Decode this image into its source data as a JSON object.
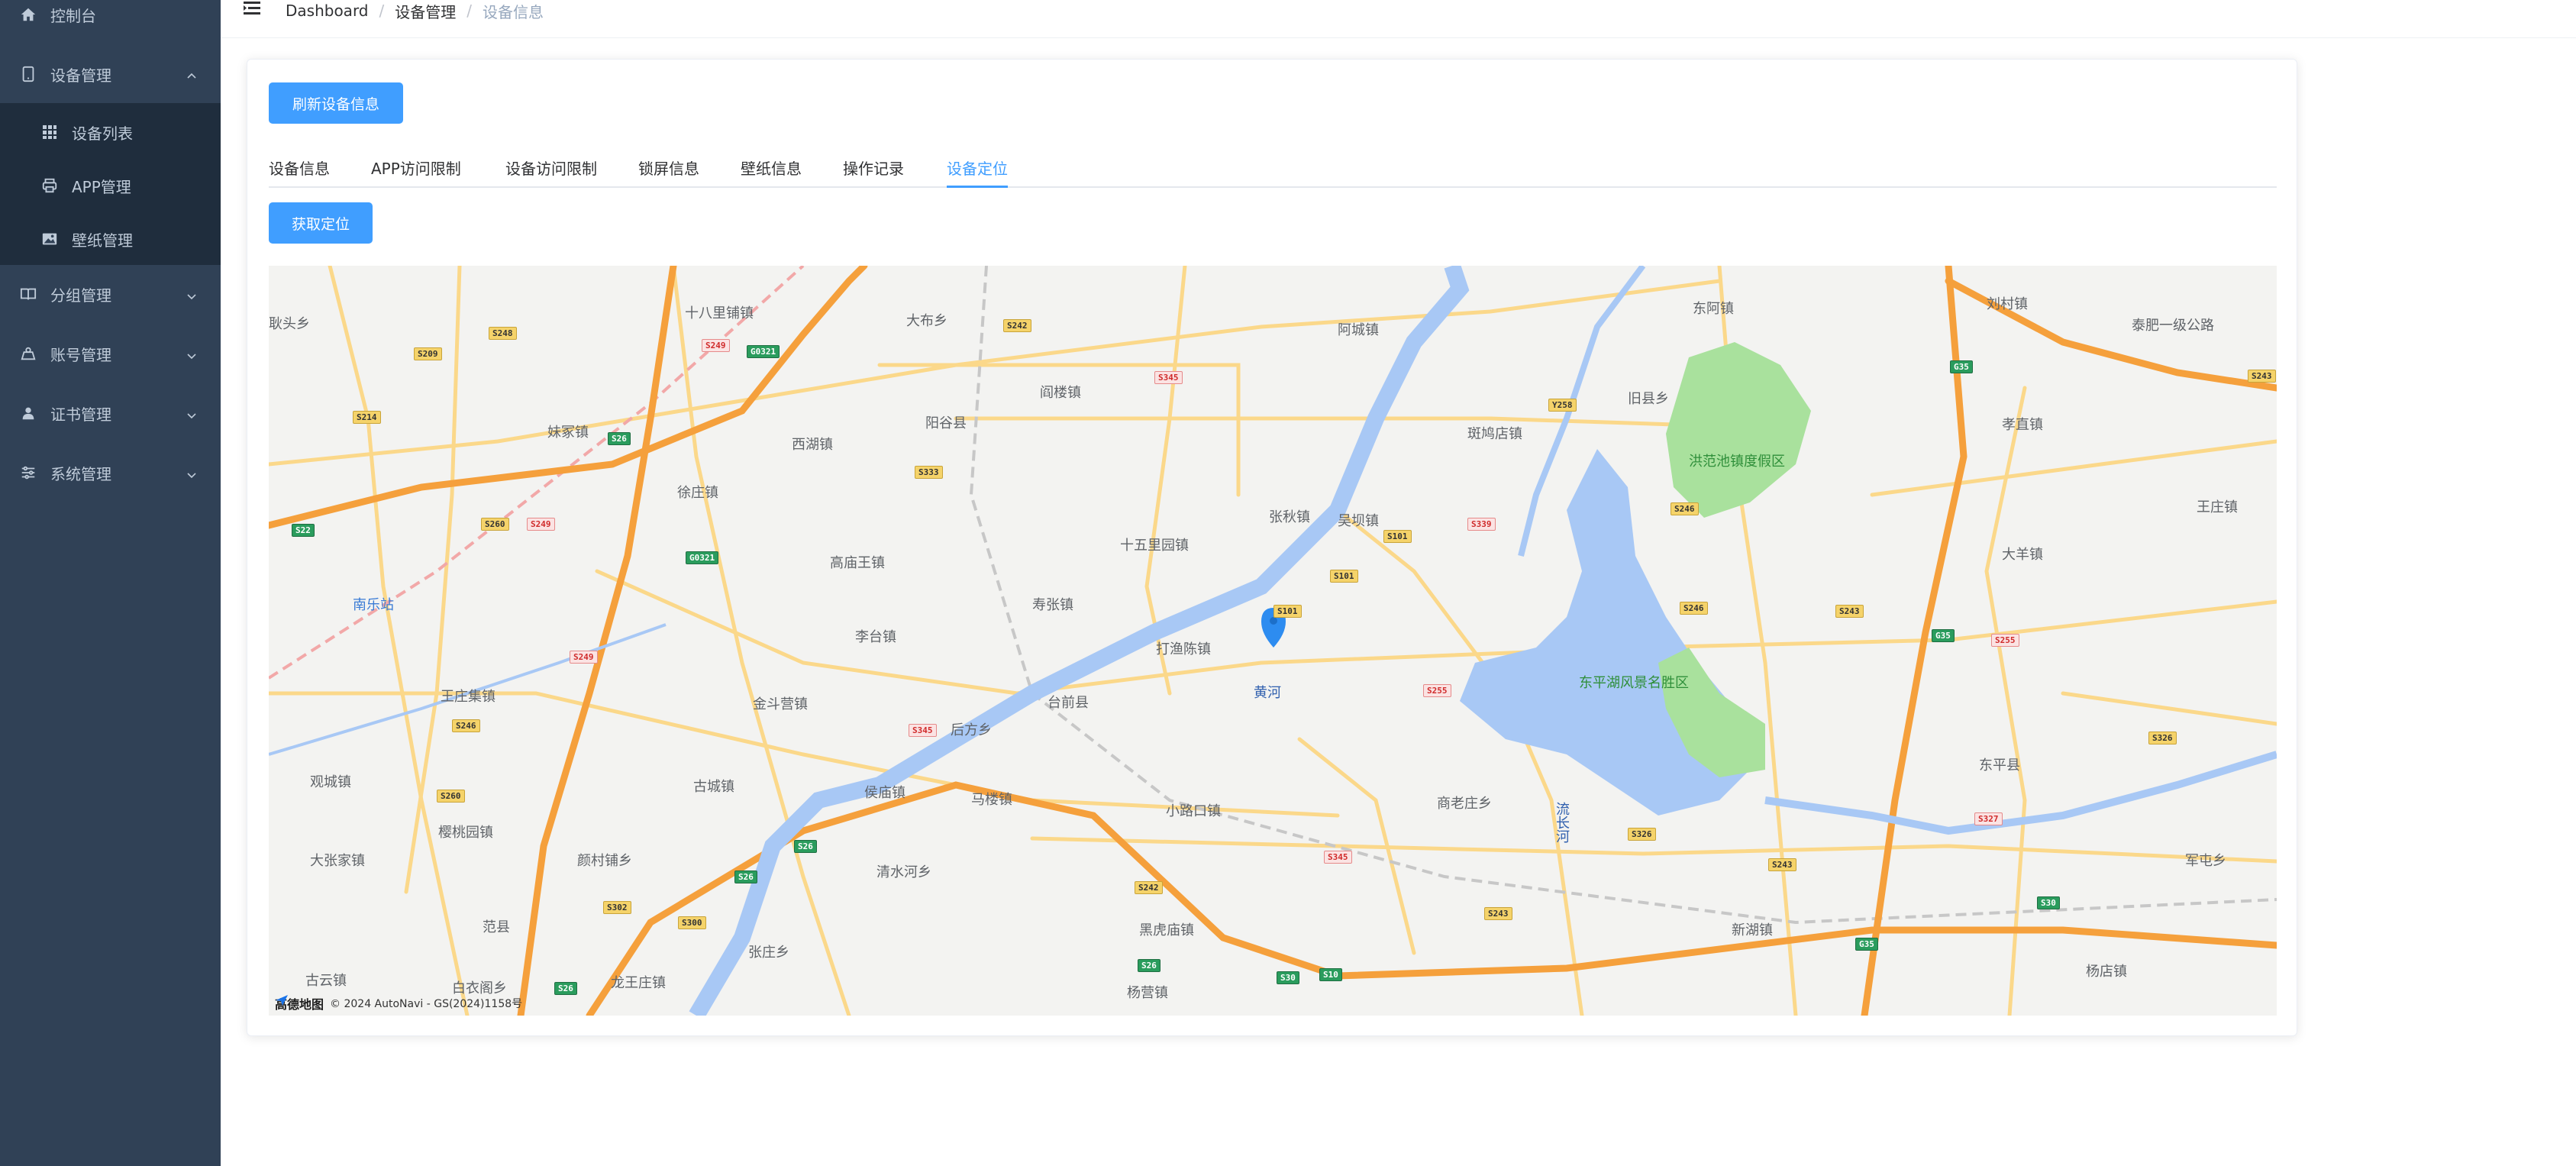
{
  "sidebar": {
    "items": [
      {
        "label": "控制台",
        "icon": "home-icon"
      },
      {
        "label": "设备管理",
        "icon": "tablet-icon"
      },
      {
        "label": "设备列表",
        "icon": "grid-icon"
      },
      {
        "label": "APP管理",
        "icon": "printer-icon"
      },
      {
        "label": "壁纸管理",
        "icon": "image-icon"
      },
      {
        "label": "分组管理",
        "icon": "book-icon"
      },
      {
        "label": "账号管理",
        "icon": "user-folder-icon"
      },
      {
        "label": "证书管理",
        "icon": "person-icon"
      },
      {
        "label": "系统管理",
        "icon": "sliders-icon"
      }
    ]
  },
  "breadcrumb": [
    "Dashboard",
    "设备管理",
    "设备信息"
  ],
  "buttons": {
    "refresh": "刷新设备信息",
    "locate": "获取定位"
  },
  "tabs": [
    "设备信息",
    "APP访问限制",
    "设备访问限制",
    "锁屏信息",
    "壁纸信息",
    "操作记录",
    "设备定位"
  ],
  "active_tab": "设备定位",
  "map": {
    "places": [
      "十八里铺镇",
      "大布乡",
      "阿城镇",
      "东阿镇",
      "刘村镇",
      "泰肥一级公路",
      "阎楼镇",
      "阳谷县",
      "旧县乡",
      "孝直镇",
      "妹冢镇",
      "西湖镇",
      "斑鸠店镇",
      "洪范池镇度假区",
      "徐庄镇",
      "张秋镇",
      "吴坝镇",
      "王庄镇",
      "十五里园镇",
      "高庙王镇",
      "大羊镇",
      "南乐站",
      "寿张镇",
      "李台镇",
      "打渔陈镇",
      "东平湖风景名胜区",
      "黄河",
      "金斗营镇",
      "台前县",
      "后方乡",
      "王庄集镇",
      "观城镇",
      "古城镇",
      "侯庙镇",
      "马楼镇",
      "小路口镇",
      "商老庄乡",
      "东平县",
      "流长河",
      "樱桃园镇",
      "大张家镇",
      "颜村铺乡",
      "清水河乡",
      "军屯乡",
      "范县",
      "张庄乡",
      "黑虎庙镇",
      "新湖镇",
      "古云镇",
      "白衣阁乡",
      "龙王庄镇",
      "杨营镇",
      "杨店镇",
      "耿头乡"
    ],
    "attribution": "© 2024 AutoNavi - GS(2024)1158号",
    "provider": "高德地图",
    "marker": "location-pin-icon",
    "colors": {
      "water": "#a8c8f5",
      "park": "#a9e19d",
      "highway": "#f5a03c",
      "road": "#fbd88a"
    }
  },
  "colors": {
    "sidebar": "#304156",
    "submenu": "#1f2d3d",
    "accent": "#409eff"
  }
}
